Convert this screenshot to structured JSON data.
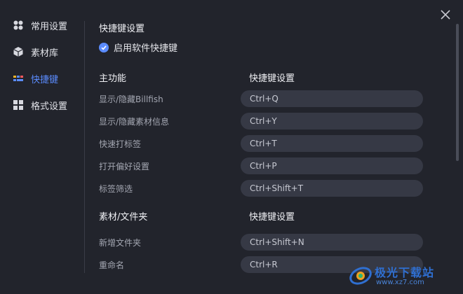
{
  "sidebar": {
    "items": [
      {
        "label": "常用设置",
        "icon": "apps-icon"
      },
      {
        "label": "素材库",
        "icon": "cube-icon"
      },
      {
        "label": "快捷键",
        "icon": "keyboard-icon",
        "active": true
      },
      {
        "label": "格式设置",
        "icon": "grid-icon"
      }
    ]
  },
  "main": {
    "title": "快捷键设置",
    "enable_label": "启用软件快捷键",
    "groups": [
      {
        "header": "主功能",
        "header_col2": "快捷键设置",
        "rows": [
          {
            "label": "显示/隐藏Billfish",
            "key": "Ctrl+Q"
          },
          {
            "label": "显示/隐藏素材信息",
            "key": "Ctrl+Y"
          },
          {
            "label": "快速打标签",
            "key": "Ctrl+T"
          },
          {
            "label": "打开偏好设置",
            "key": "Ctrl+P"
          },
          {
            "label": "标签筛选",
            "key": "Ctrl+Shift+T"
          }
        ]
      },
      {
        "header": "素材/文件夹",
        "header_col2": "快捷键设置",
        "rows": [
          {
            "label": "新增文件夹",
            "key": "Ctrl+Shift+N"
          },
          {
            "label": "重命名",
            "key": "Ctrl+R"
          }
        ]
      }
    ]
  },
  "watermark": {
    "text": "极光下载站",
    "url": "www.xz7.com"
  },
  "colors": {
    "accent": "#5b8cff",
    "background": "#22242c",
    "key_field": "#363945"
  }
}
